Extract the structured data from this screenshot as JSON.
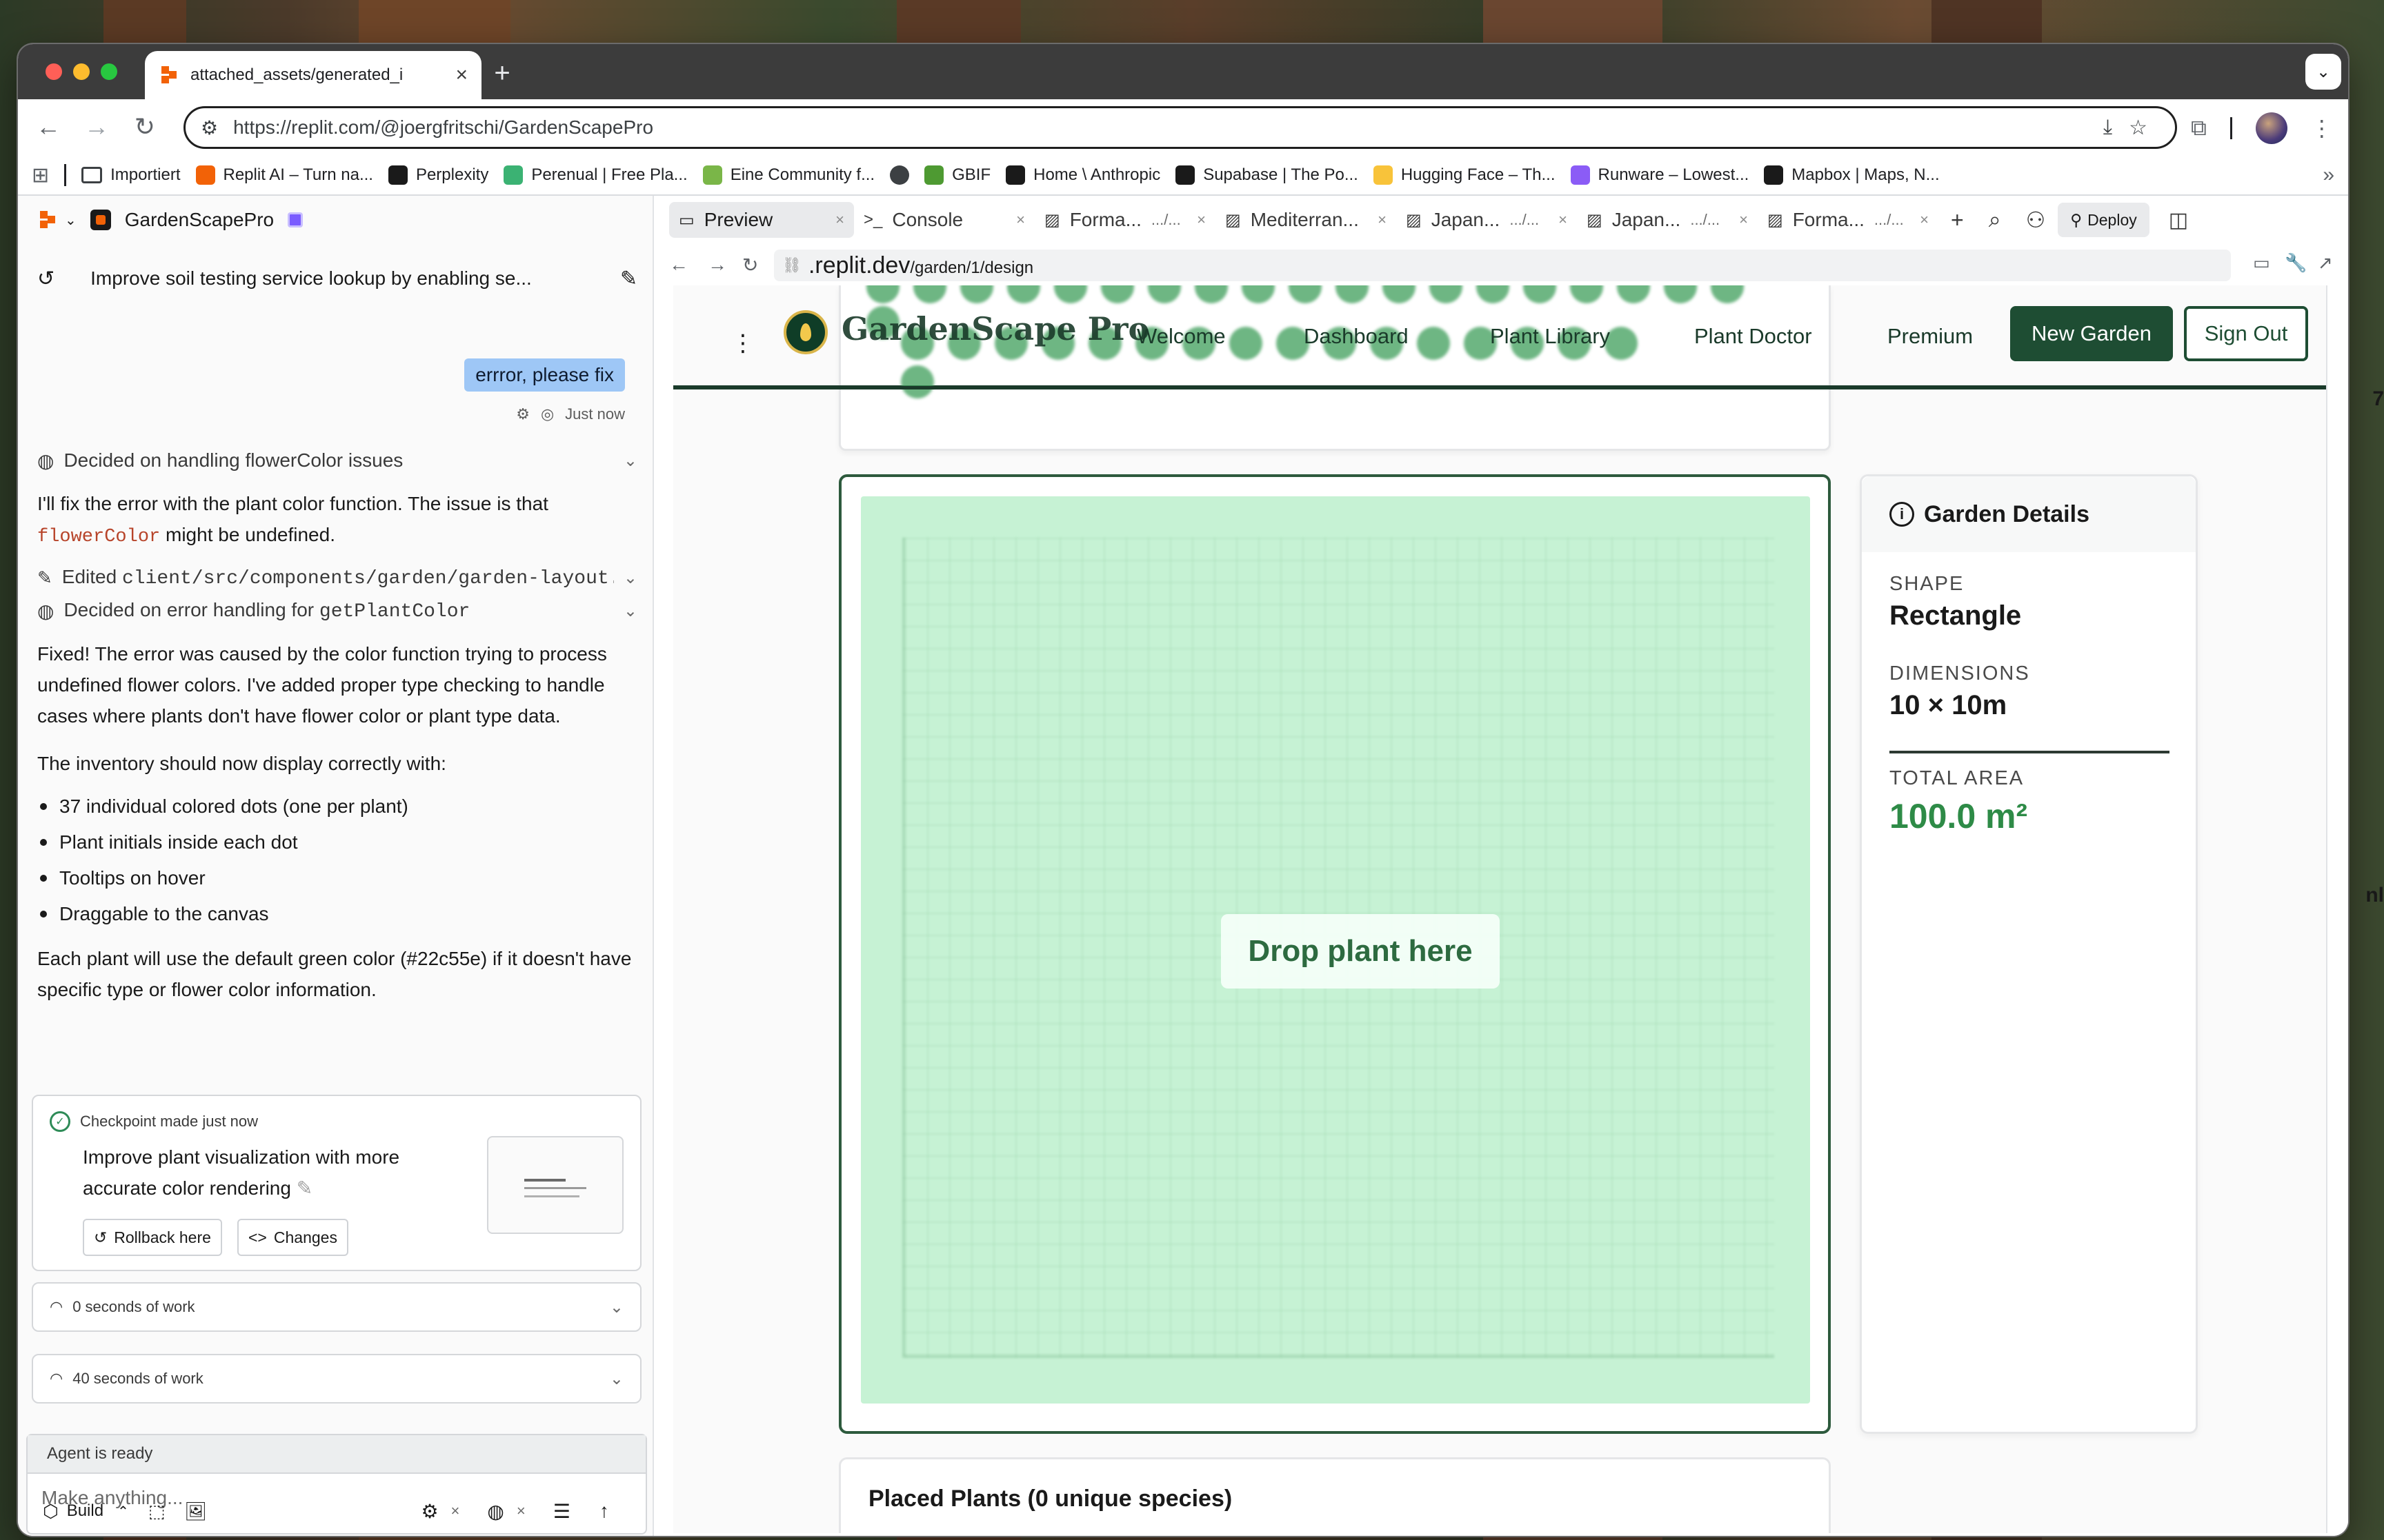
{
  "browser": {
    "tab_title": "attached_assets/generated_i",
    "url": "https://replit.com/@joergfritschi/GardenScapePro",
    "bookmarks": [
      {
        "label": "Importiert",
        "icon": "folder-icon",
        "color": "#ffffff"
      },
      {
        "label": "Replit AI – Turn na...",
        "icon": "replit-icon",
        "color": "#f26207"
      },
      {
        "label": "Perplexity",
        "icon": "perplexity-icon",
        "color": "#1a1a1a"
      },
      {
        "label": "Perenual | Free Pla...",
        "icon": "perenual-icon",
        "color": "#3bb273"
      },
      {
        "label": "Eine Community f...",
        "icon": "plant-icon",
        "color": "#7ab648"
      },
      {
        "label": "",
        "icon": "globe-icon",
        "color": "#5f6368"
      },
      {
        "label": "GBIF",
        "icon": "gbif-icon",
        "color": "#4e9a32"
      },
      {
        "label": "Home \\ Anthropic",
        "icon": "anthropic-icon",
        "color": "#1a1a1a"
      },
      {
        "label": "Supabase | The Po...",
        "icon": "supabase-icon",
        "color": "#1a1a1a"
      },
      {
        "label": "Hugging Face – Th...",
        "icon": "huggingface-icon",
        "color": "#f8c33a"
      },
      {
        "label": "Runware – Lowest...",
        "icon": "runware-icon",
        "color": "#8b5cf6"
      },
      {
        "label": "Mapbox | Maps, N...",
        "icon": "mapbox-icon",
        "color": "#1a1a1a"
      }
    ]
  },
  "agent": {
    "project_name": "GardenScapePro",
    "thread_title": "Improve soil testing service lookup by enabling se...",
    "user_message": "errror, please fix",
    "timestamp": "Just now",
    "decision_1": "Decided on handling flowerColor issues",
    "msg_1_a": "I'll fix the error with the plant color function. The issue is that",
    "msg_1_code": "flowerColor",
    "msg_1_b": "might be undefined.",
    "edited_prefix": "Edited",
    "edited_path": "client/src/components/garden/garden-layout...",
    "decision_2_prefix": "Decided on error handling for",
    "decision_2_code": "getPlantColor",
    "msg_2": "Fixed! The error was caused by the color function trying to process undefined flower colors. I've added proper type checking to handle cases where plants don't have flower color or plant type data.",
    "msg_3": "The inventory should now display correctly with:",
    "bullets": [
      "37 individual colored dots (one per plant)",
      "Plant initials inside each dot",
      "Tooltips on hover",
      "Draggable to the canvas"
    ],
    "msg_4": "Each plant will use the default green color (#22c55e) if it doesn't have specific type or flower color information.",
    "checkpoint": {
      "title": "Checkpoint made just now",
      "description": "Improve plant visualization with more accurate color rendering",
      "rollback_label": "Rollback here",
      "changes_label": "Changes"
    },
    "work_rows": [
      "0 seconds of work",
      "40 seconds of work"
    ],
    "status": "Agent is ready",
    "input_placeholder": "Make anything...",
    "build_label": "Build"
  },
  "workspace": {
    "tabs": [
      {
        "label": "Preview",
        "icon": "monitor-icon",
        "active": true
      },
      {
        "label": "Console",
        "icon": "terminal-icon"
      },
      {
        "label": "Forma...",
        "suffix": ".../...",
        "icon": "image-icon"
      },
      {
        "label": "Mediterran...",
        "icon": "image-icon"
      },
      {
        "label": "Japan...",
        "suffix": ".../...",
        "icon": "image-icon"
      },
      {
        "label": "Japan...",
        "suffix": ".../...",
        "icon": "image-icon"
      },
      {
        "label": "Forma...",
        "suffix": ".../...",
        "icon": "image-icon"
      }
    ],
    "deploy_label": "Deploy",
    "preview_host": ".replit.dev",
    "preview_path": "/garden/1/design"
  },
  "app": {
    "brand": "GardenScape Pro",
    "nav": [
      "Welcome",
      "Dashboard",
      "Plant Library",
      "Plant Doctor",
      "Premium"
    ],
    "new_garden_label": "New Garden",
    "sign_out_label": "Sign Out",
    "drop_label": "Drop plant here",
    "details": {
      "title": "Garden Details",
      "shape_label": "SHAPE",
      "shape_value": "Rectangle",
      "dimensions_label": "DIMENSIONS",
      "dimensions_value": "10 × 10m",
      "area_label": "TOTAL AREA",
      "area_value": "100.0 m²"
    },
    "placed_title": "Placed Plants (0 unique species)"
  },
  "colors": {
    "brand_dark": "#1e4d33",
    "canvas": "#c6f2d4",
    "area_green": "#2e8b47",
    "user_bubble": "#9ec7f6"
  },
  "edge_fragments": [
    "7",
    "nl"
  ]
}
